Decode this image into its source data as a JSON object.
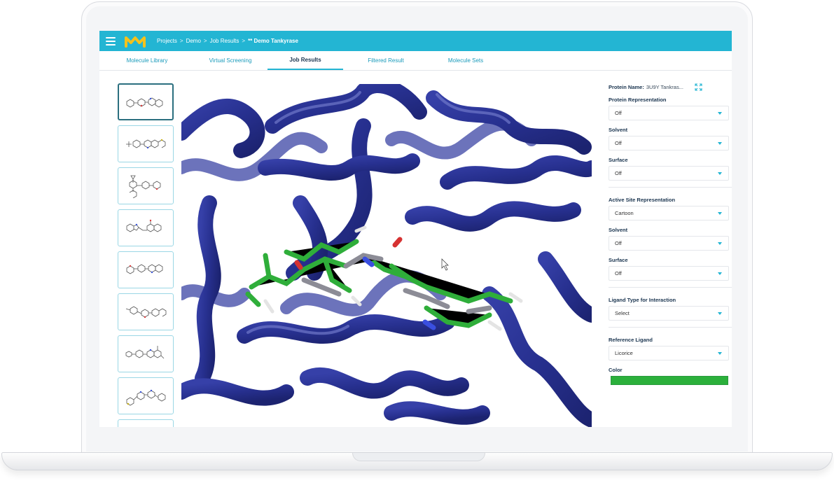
{
  "header": {
    "breadcrumbs": [
      "Projects",
      ">",
      "Demo",
      ">",
      "Job Results",
      ">"
    ],
    "current": "** Demo Tankyrase"
  },
  "tabs": [
    {
      "label": "Molecule Library",
      "active": false
    },
    {
      "label": "Virtual Screening",
      "active": false
    },
    {
      "label": "Job Results",
      "active": true
    },
    {
      "label": "Filtered Result",
      "active": false
    },
    {
      "label": "Molecule Sets",
      "active": false
    }
  ],
  "panel": {
    "protein_name_label": "Protein Name:",
    "protein_name_value": "3U9Y Tankras...",
    "protein_section": [
      {
        "label": "Protein Representation",
        "value": "Off"
      },
      {
        "label": "Solvent",
        "value": "Off"
      },
      {
        "label": "Surface",
        "value": "Off"
      }
    ],
    "active_site_section": [
      {
        "label": "Active Site Representation",
        "value": "Cartoon"
      },
      {
        "label": "Solvent",
        "value": "Off"
      },
      {
        "label": "Surface",
        "value": "Off"
      }
    ],
    "ligand_type": {
      "label": "Ligand Type for Interaction",
      "value": "Select"
    },
    "reference_ligand": {
      "label": "Reference Ligand",
      "value": "Licorice"
    },
    "color_label": "Color",
    "color_value": "#2bb03b"
  },
  "colors": {
    "accent": "#23b5d3",
    "ribbon": "#2a3596",
    "ligand": "#2fae3a"
  },
  "icons": {
    "menu": "hamburger-icon",
    "logo": "m-logo-icon",
    "expand": "expand-icon",
    "dropdown": "caret-down-icon"
  }
}
